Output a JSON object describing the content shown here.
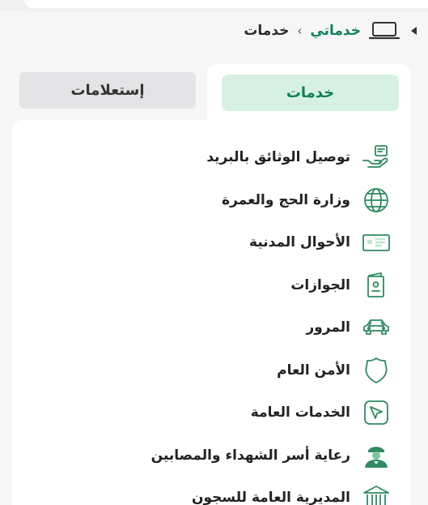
{
  "breadcrumb": {
    "parent": "خدماتي",
    "separator": "›",
    "current": "خدمات"
  },
  "tabs": {
    "services": "خدمات",
    "inquiries": "إستعلامات"
  },
  "services": [
    {
      "label": "توصيل الوثائق بالبريد",
      "icon": "hand-card-icon"
    },
    {
      "label": "وزارة الحج والعمرة",
      "icon": "globe-icon"
    },
    {
      "label": "الأحوال المدنية",
      "icon": "id-card-icon"
    },
    {
      "label": "الجوازات",
      "icon": "passport-icon"
    },
    {
      "label": "المرور",
      "icon": "car-icon"
    },
    {
      "label": "الأمن العام",
      "icon": "shield-icon"
    },
    {
      "label": "الخدمات العامة",
      "icon": "cursor-icon"
    },
    {
      "label": "رعاية أسر الشهداء والمصابين",
      "icon": "soldier-icon"
    },
    {
      "label": "المديرية العامة للسجون",
      "icon": "building-icon"
    }
  ],
  "colors": {
    "accent": "#12805c",
    "accent_bg": "#d6f1e3",
    "icon_stroke": "#2f8a63"
  }
}
